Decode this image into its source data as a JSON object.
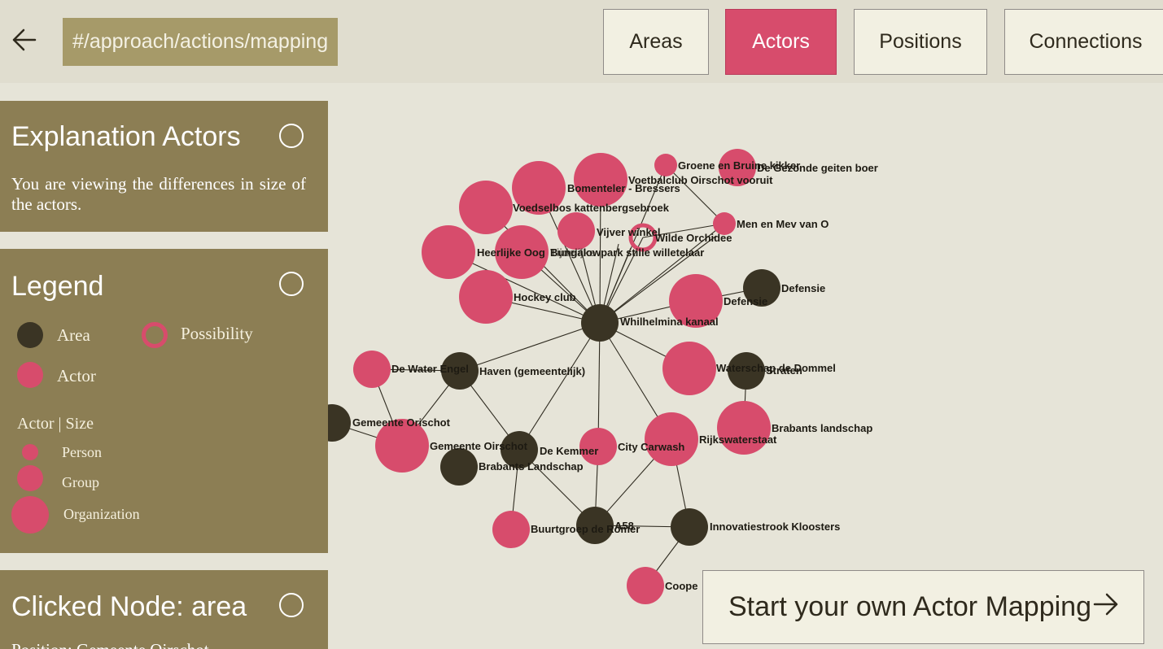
{
  "header": {
    "url": "#/approach/actions/mapping",
    "tabs": [
      {
        "label": "Areas",
        "active": false
      },
      {
        "label": "Actors",
        "active": true
      },
      {
        "label": "Positions",
        "active": false
      },
      {
        "label": "Connections",
        "active": false
      }
    ]
  },
  "explanation": {
    "title": "Explanation Actors",
    "text": "You are viewing the differences in size of the actors."
  },
  "legend": {
    "title": "Legend",
    "area_label": "Area",
    "possibility_label": "Possibility",
    "actor_label": "Actor",
    "size_title": "Actor | Size",
    "sizes": [
      "Person",
      "Group",
      "Organization"
    ]
  },
  "clicked": {
    "title": "Clicked Node: area",
    "text": "Position: Gemeente Oirschot"
  },
  "graph": {
    "colors": {
      "area": "#3a3424",
      "actor": "#d74c6c",
      "edge": "#2f2b20"
    },
    "labels": [
      "Groene en Bruine kikker",
      "De Gezonde geiten boer",
      "Voetbalclub Oirschot vooruit",
      "Bomenteler - Bressers",
      "Voedselbos kattenbergsebroek",
      "Men en Mev van O",
      "Vijver winkel",
      "Wilde Orchidee",
      "Heerlijke Oog",
      "Bungalowpark stille willetelaar",
      "Tijdelijke",
      "Hockey club",
      "Defensie",
      "Defensie",
      "Whilhelmina kanaal",
      "De Water Engel",
      "Haven (gemeentelijk)",
      "Waterschap de Dommel",
      "Straten",
      "Gemeente Orischot",
      "Brabants landschap",
      "Gemeente Oirschot",
      "De Kemmer",
      "City Carwash",
      "Rijkswaterstaat",
      "Brabants Landschap",
      "Buurtgroep de Romer",
      "A58",
      "Innovatiestrook Kloosters",
      "Coope"
    ]
  },
  "cta": {
    "label": "Start your own Actor Mapping",
    "icon": "arrow-right-icon"
  },
  "icons": {
    "back": "arrow-left-icon",
    "toggle": "circle-toggle-icon"
  }
}
